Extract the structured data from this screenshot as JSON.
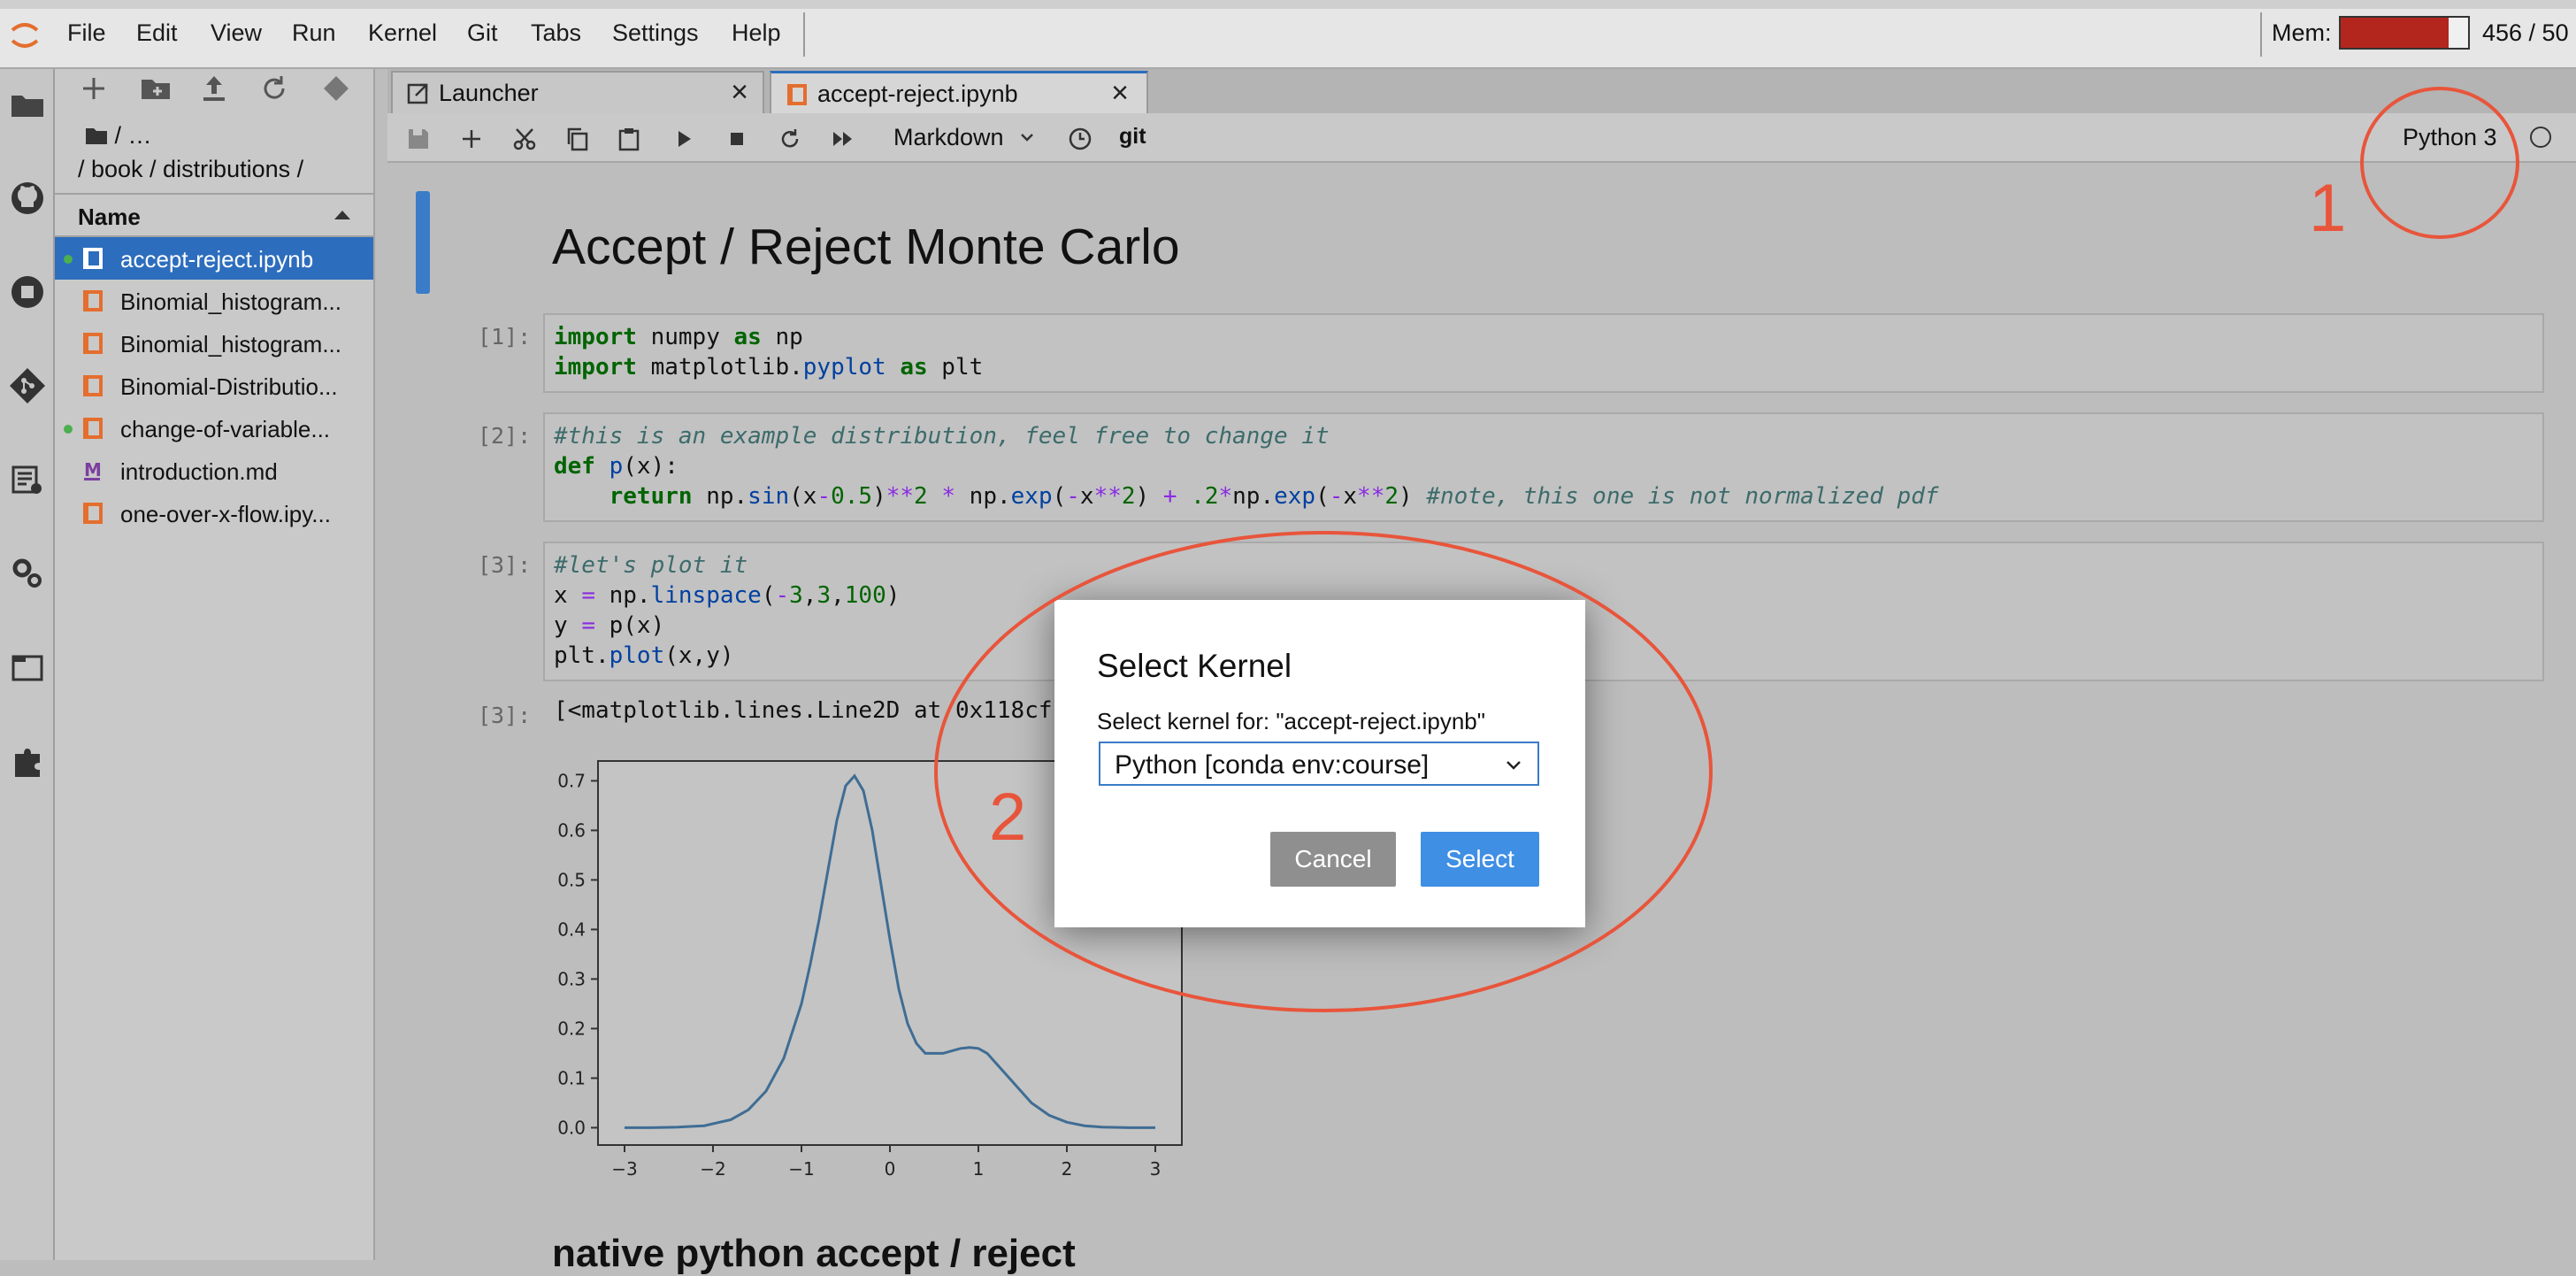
{
  "menu": [
    "File",
    "Edit",
    "View",
    "Run",
    "Kernel",
    "Git",
    "Tabs",
    "Settings",
    "Help"
  ],
  "memory": {
    "label": "Mem:",
    "text": "456 / 50",
    "fraction": 0.85,
    "fill_color": "#b3261e"
  },
  "file_browser": {
    "breadcrumb_top": "/ …",
    "path": "/ book / distributions /",
    "column_header": "Name",
    "files": [
      {
        "name": "accept-reject.ipynb",
        "type": "notebook",
        "selected": true,
        "running": true
      },
      {
        "name": "Binomial_histogram...",
        "type": "notebook",
        "selected": false,
        "running": false
      },
      {
        "name": "Binomial_histogram...",
        "type": "notebook",
        "selected": false,
        "running": false
      },
      {
        "name": "Binomial-Distributio...",
        "type": "notebook",
        "selected": false,
        "running": false
      },
      {
        "name": "change-of-variable...",
        "type": "notebook",
        "selected": false,
        "running": true
      },
      {
        "name": "introduction.md",
        "type": "markdown",
        "selected": false,
        "running": false
      },
      {
        "name": "one-over-x-flow.ipy...",
        "type": "notebook",
        "selected": false,
        "running": false
      }
    ]
  },
  "tabs": [
    {
      "label": "Launcher",
      "active": false
    },
    {
      "label": "accept-reject.ipynb",
      "active": true
    }
  ],
  "toolbar": {
    "cell_type": "Markdown",
    "git_label": "git",
    "kernel_name": "Python 3"
  },
  "notebook": {
    "title": "Accept / Reject Monte Carlo",
    "prompts": [
      "[1]:",
      "[2]:",
      "[3]:",
      "[3]:"
    ],
    "output_text": "[<matplotlib.lines.Line2D at 0x118cf",
    "next_heading": "native python accept / reject"
  },
  "annotations": {
    "one": "1",
    "two": "2",
    "color": "#e8553b"
  },
  "dialog": {
    "title": "Select Kernel",
    "label": "Select kernel for: \"accept-reject.ipynb\"",
    "selected_kernel": "Python [conda env:course]",
    "cancel": "Cancel",
    "select": "Select"
  },
  "chart_data": {
    "type": "line",
    "xlim": [
      -3.3,
      3.3
    ],
    "ylim": [
      -0.035,
      0.74
    ],
    "xticks": [
      -3,
      -2,
      -1,
      0,
      1,
      2,
      3
    ],
    "yticks": [
      0.0,
      0.1,
      0.2,
      0.3,
      0.4,
      0.5,
      0.6,
      0.7
    ],
    "x": [
      -3.0,
      -2.7,
      -2.4,
      -2.1,
      -1.8,
      -1.6,
      -1.4,
      -1.2,
      -1.0,
      -0.9,
      -0.8,
      -0.7,
      -0.6,
      -0.5,
      -0.4,
      -0.3,
      -0.2,
      -0.1,
      0.0,
      0.1,
      0.2,
      0.3,
      0.4,
      0.5,
      0.6,
      0.7,
      0.8,
      0.9,
      1.0,
      1.1,
      1.2,
      1.4,
      1.6,
      1.8,
      2.0,
      2.2,
      2.4,
      2.7,
      3.0
    ],
    "y": [
      0.0,
      0.0,
      0.001,
      0.004,
      0.016,
      0.036,
      0.074,
      0.14,
      0.25,
      0.33,
      0.42,
      0.52,
      0.62,
      0.69,
      0.71,
      0.68,
      0.6,
      0.49,
      0.38,
      0.28,
      0.21,
      0.17,
      0.15,
      0.15,
      0.15,
      0.155,
      0.16,
      0.162,
      0.16,
      0.15,
      0.13,
      0.09,
      0.05,
      0.025,
      0.011,
      0.004,
      0.001,
      0.0,
      0.0
    ],
    "line_color": "#3f6d94"
  }
}
